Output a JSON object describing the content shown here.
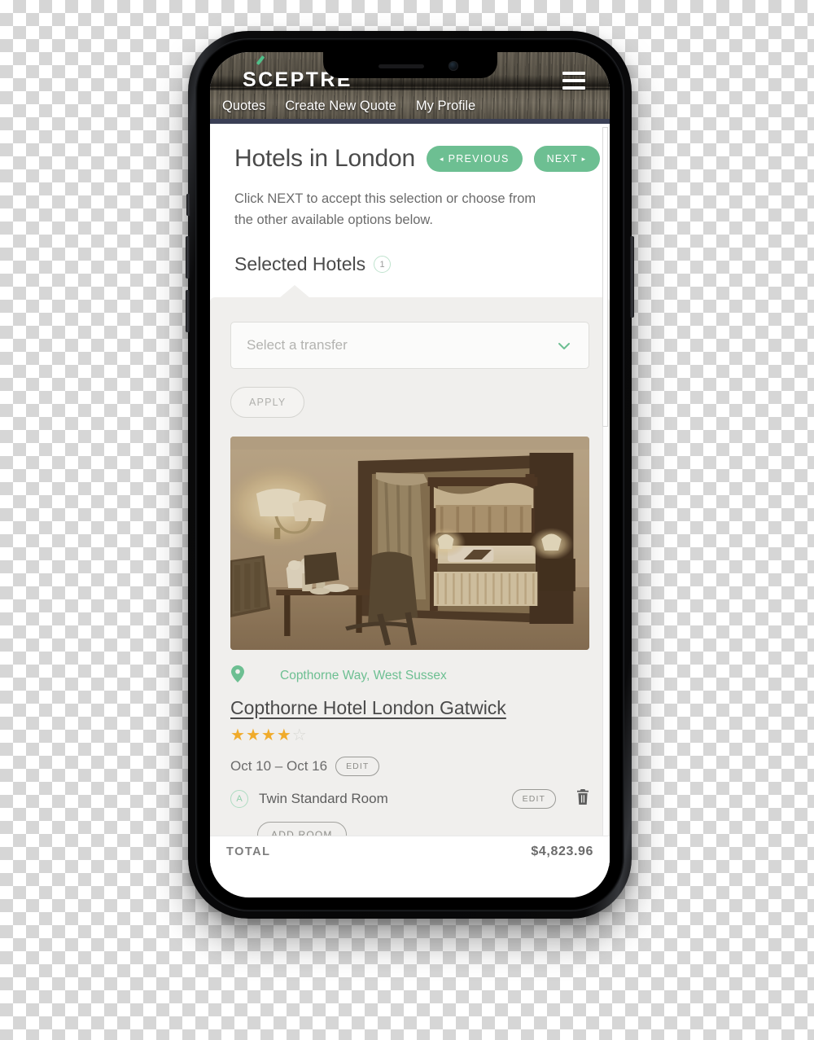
{
  "app": {
    "logo": "SCEPTRE",
    "menu_icon": "hamburger-menu-icon"
  },
  "nav": {
    "items": [
      {
        "label": "Quotes"
      },
      {
        "label": "Create New Quote"
      },
      {
        "label": "My Profile"
      }
    ]
  },
  "page": {
    "title": "Hotels in London",
    "previous_label": "PREVIOUS",
    "next_label": "NEXT",
    "previous_arrow": "◂",
    "next_arrow": "▸",
    "instructions": "Click NEXT to accept this selection or choose from the other available options below."
  },
  "selected_hotels": {
    "heading": "Selected Hotels",
    "count": "1"
  },
  "transfer": {
    "placeholder": "Select a transfer",
    "chevron_icon": "chevron-down-icon",
    "apply_label": "APPLY"
  },
  "hotel": {
    "photo_alt": "hotel-room-photo",
    "location_icon": "location-pin-icon",
    "location": "Copthorne Way, West Sussex",
    "name": "Copthorne Hotel London Gatwick",
    "stars_filled": 4,
    "stars_total": 5,
    "dates": "Oct 10 – Oct 16",
    "dates_edit_label": "EDIT",
    "room": {
      "badge": "A",
      "name": "Twin Standard Room",
      "edit_label": "EDIT",
      "delete_icon": "trash-icon"
    },
    "add_room_label": "ADD ROOM"
  },
  "footer": {
    "total_label": "TOTAL",
    "total_value": "$4,823.96"
  },
  "colors": {
    "accent_green": "#6dbf92",
    "star_gold": "#f0ab2b",
    "card_gray": "#f0efed",
    "nav_strip": "#3a3f55",
    "text_dark": "#4a4a4a"
  }
}
